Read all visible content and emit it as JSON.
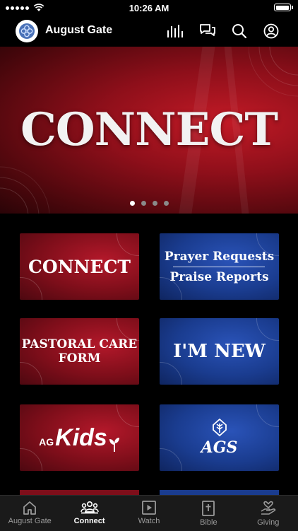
{
  "status_bar": {
    "time": "10:26 AM"
  },
  "header": {
    "app_title": "August Gate"
  },
  "hero": {
    "title": "CONNECT",
    "slide_count": 4,
    "active_slide": 1
  },
  "tiles": [
    {
      "title": "CONNECT"
    },
    {
      "line1": "Prayer Requests",
      "line2": "Praise Reports"
    },
    {
      "line1": "PASTORAL CARE",
      "line2": "FORM"
    },
    {
      "title": "I'M NEW"
    },
    {
      "prefix": "AG",
      "title": "Kids"
    },
    {
      "title": "AGS"
    }
  ],
  "tabs": [
    {
      "label": "August Gate",
      "icon": "home-icon"
    },
    {
      "label": "Connect",
      "icon": "people-icon",
      "active": true
    },
    {
      "label": "Watch",
      "icon": "play-icon"
    },
    {
      "label": "Bible",
      "icon": "bible-icon"
    },
    {
      "label": "Giving",
      "icon": "giving-icon"
    }
  ]
}
